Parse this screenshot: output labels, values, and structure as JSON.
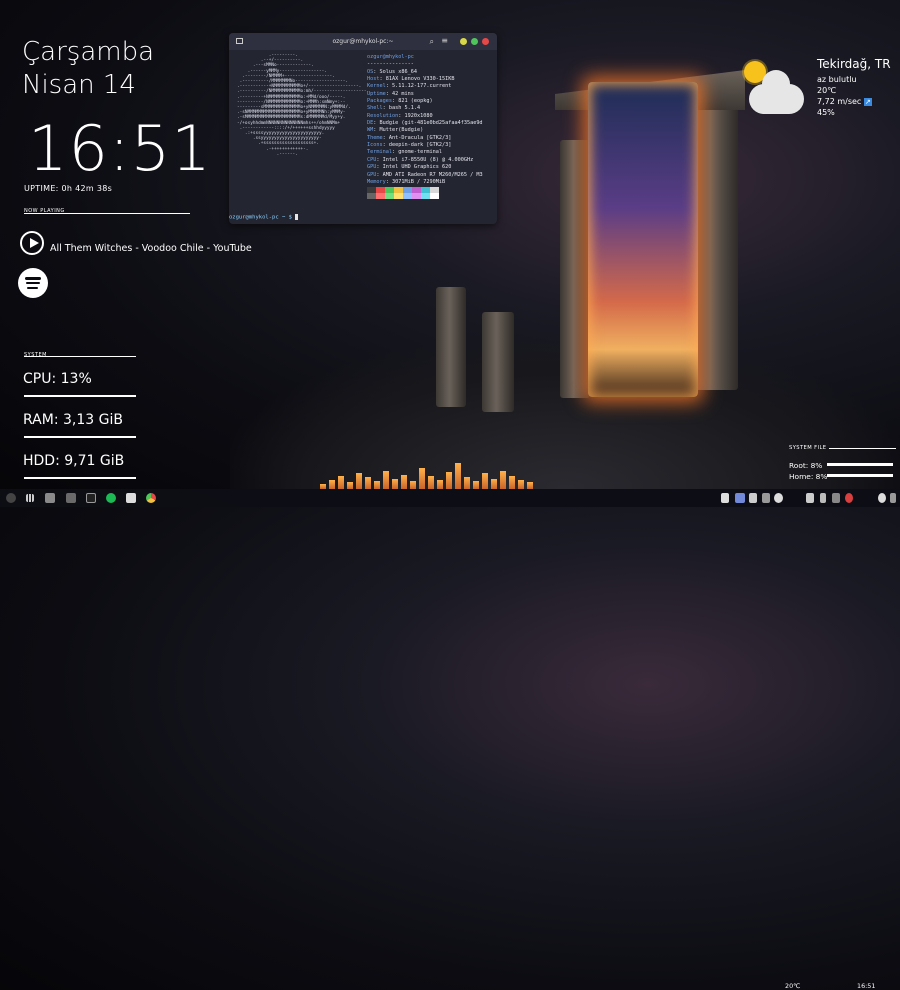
{
  "clock": {
    "day": "Çarşamba",
    "date": "Nisan 14",
    "time": "16:51",
    "uptime": "UPTIME: 0h 42m 38s"
  },
  "now_playing": {
    "title": "NOW PLAYING",
    "song": "All Them Witches - Voodoo Chile - YouTube"
  },
  "system": {
    "title": "SYSTEM",
    "cpu": "CPU: 13%",
    "cpu_value": 13,
    "ram": "RAM: 3,13 GiB",
    "hdd": "HDD: 9,71 GiB"
  },
  "terminal": {
    "title": "ozgur@mhykol-pc:~",
    "user_host": "ozgur@mhykol-pc",
    "separator": "---------------",
    "info": [
      {
        "k": "OS",
        "v": "Solus x86_64"
      },
      {
        "k": "Host",
        "v": "81AX Lenovo V330-15IKB"
      },
      {
        "k": "Kernel",
        "v": "5.11.12-177.current"
      },
      {
        "k": "Uptime",
        "v": "42 mins"
      },
      {
        "k": "Packages",
        "v": "821 (eopkg)"
      },
      {
        "k": "Shell",
        "v": "bash 5.1.4"
      },
      {
        "k": "Resolution",
        "v": "1920x1080"
      },
      {
        "k": "DE",
        "v": "Budgie (git-481e0bd25afaa4f35ae9d"
      },
      {
        "k": "WM",
        "v": "Mutter(Budgie)"
      },
      {
        "k": "Theme",
        "v": "Ant-Dracula [GTK2/3]"
      },
      {
        "k": "Icons",
        "v": "deepin-dark [GTK2/3]"
      },
      {
        "k": "Terminal",
        "v": "gnome-terminal"
      },
      {
        "k": "CPU",
        "v": "Intel i7-8550U (8) @ 4.000GHz"
      },
      {
        "k": "GPU",
        "v": "Intel UHD Graphics 620"
      },
      {
        "k": "GPU",
        "v": "AMD ATI Radeon R7 M260/M265 / M3"
      },
      {
        "k": "Memory",
        "v": "3071MiB / 7290MiB"
      }
    ],
    "prompt": "ozgur@mhykol-pc ~ $",
    "ascii_art": "            .---------.\n         .--+/----------.\n      .---sMMNo-------------.\n    .------yMMMy-----------------.\n  .--------/NMMMM+------------------.\n .----------/MMMMMMMNo-------------------.\n.-----------+NMMMMMMMMMMo+/-------------------.\n.----------/NMMMMMMMMMMMo:mh/--------------------.\n.---------+NMMMMMMMMMMMMo:+MMd/ooo/-----.\n----------/NMMMMMMMMMMMMo:+MMMh:smNmy+:--\n---------sMMMMMMMMMMMMMMo+yNMMMMMN:yMMMMd/.\n.-sNMMMMMMMMMMMMMMMMMMMMo+yMMMMMNh:yMMMy-\n.-sMMMMMMMMMMMMMMMMMMMMMs:dMMMMMMd/Myy+y.\n-/+osyhhdmmNNNNNNNNNNNNNNmhs++/ohmNNMm+\n .------------::::/+/++++++sshhdyyyyy\n   .:+ssssyyyyyyyyyyyyyyyyyyyyyy.\n      .ssyyyyyyyyyyyyyyyyyyyyyy-\n        .+sssssssssssssssssss+.\n           .-++++++++++++-.\n               .------."
  },
  "weather": {
    "city": "Tekirdağ, TR",
    "condition": "az bulutlu",
    "temp": "20℃",
    "wind": "7,72 m/sec",
    "humidity": "45%"
  },
  "system_file": {
    "title": "SYSTEM FILE",
    "root": "Root: 8%",
    "root_value": 8,
    "home": "Home: 8%",
    "home_value": 8
  },
  "taskbar": {
    "temp": "20℃",
    "time": "16:51"
  },
  "colors": {
    "accent_orange": "#ff8a3a",
    "terminal_bg": "#232530",
    "terminal_key": "#6fa0e6",
    "close_red": "#e64848",
    "min_yellow": "#d8d84a",
    "max_green": "#4ec65a",
    "spotify_icon": "#ffffff",
    "sun": "#f6c21b"
  },
  "icons": [
    "terminal-icon",
    "search-icon",
    "hamburger-menu-icon",
    "play-circle-icon",
    "spotify-icon",
    "sun-cloud-icon",
    "wind-arrow-icon",
    "apps-grid-icon",
    "files-icon",
    "terminal-app-icon",
    "spotify-app-icon",
    "chrome-icon",
    "discord-icon",
    "volume-icon",
    "bluetooth-icon",
    "power-icon"
  ],
  "eq_levels": [
    0.2,
    0.35,
    0.5,
    0.25,
    0.6,
    0.45,
    0.3,
    0.7,
    0.4,
    0.55,
    0.3,
    0.8,
    0.5,
    0.35,
    0.65,
    1.0,
    0.45,
    0.3,
    0.6,
    0.4,
    0.7,
    0.5,
    0.35,
    0.25
  ]
}
